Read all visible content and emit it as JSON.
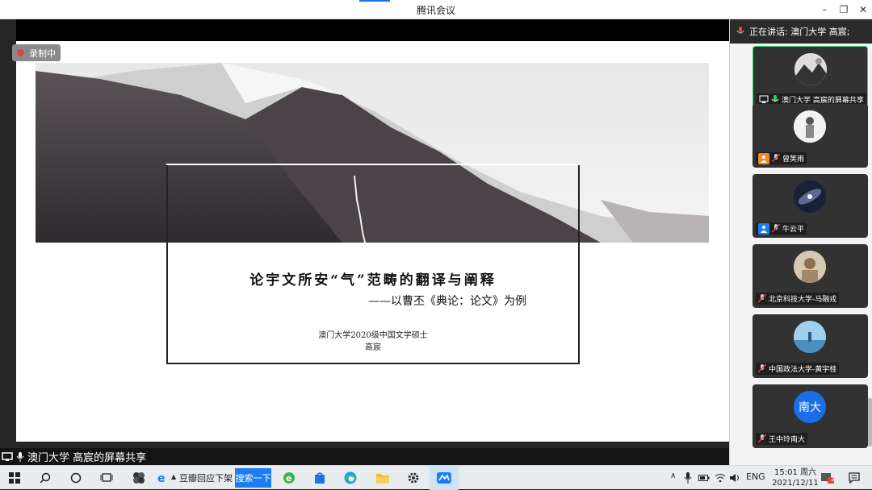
{
  "window": {
    "title": "腾讯会议",
    "minimize": "–",
    "restore": "❐",
    "close": "✕"
  },
  "recording": {
    "label": "录制中"
  },
  "slide": {
    "title": "论宇文所安“气”范畴的翻译与阐释",
    "subtitle": "——以曹丕《典论：论文》为例",
    "author_line1": "澳门大学2020级中国文学硕士",
    "author_line2": "高宸"
  },
  "share_caption": "澳门大学 高宸的屏幕共享",
  "right_panel": {
    "speaking": "正在讲话: 澳门大学 高宸;",
    "participants": [
      {
        "name": "澳门大学 高宸的屏幕共享"
      },
      {
        "name": "曾笑雨"
      },
      {
        "name": "牛云平"
      },
      {
        "name": "北京科技大学-马融戎"
      },
      {
        "name": "中国政法大学-黄宇桂"
      },
      {
        "name": "王中玲南大",
        "avatar_text": "南大"
      }
    ]
  },
  "taskbar": {
    "browser_tab": "豆瓣回应下架",
    "search_button": "搜索一下",
    "lang": "ENG",
    "time": "15:01 周六",
    "date": "2021/12/11",
    "notif_count": "3"
  },
  "colors": {
    "accent": "#1a73e8",
    "active_border": "#2ecc71",
    "record": "#e04444"
  }
}
